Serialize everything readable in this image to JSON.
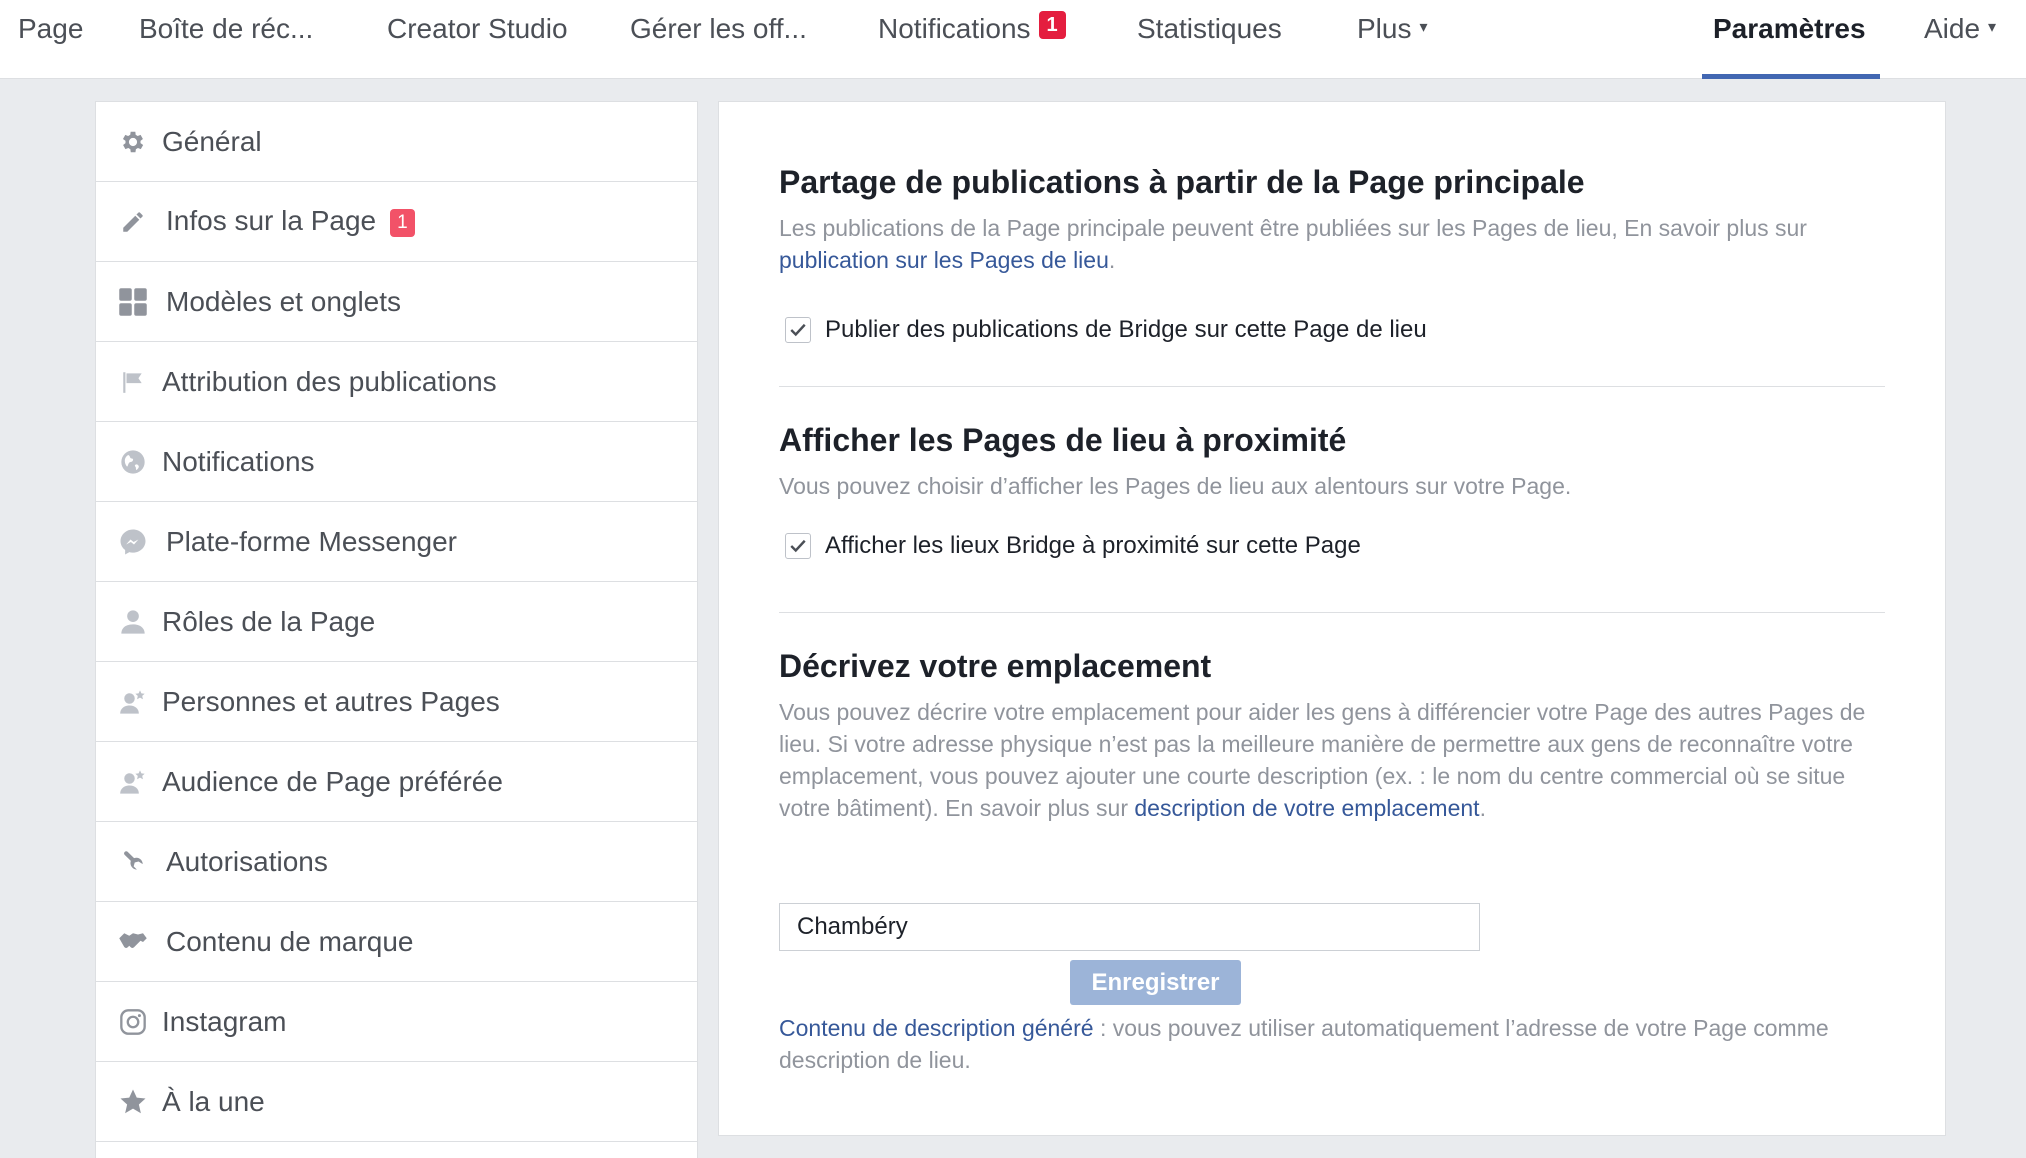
{
  "topnav": {
    "items": [
      {
        "label": "Page"
      },
      {
        "label": "Boîte de réc..."
      },
      {
        "label": "Creator Studio"
      },
      {
        "label": "Gérer les off..."
      },
      {
        "label": "Notifications",
        "badge": "1"
      },
      {
        "label": "Statistiques"
      },
      {
        "label": "Plus"
      },
      {
        "label": "Paramètres"
      },
      {
        "label": "Aide"
      }
    ],
    "caret": "▾",
    "accent_color": "#4267b2"
  },
  "sidebar": {
    "items": [
      {
        "label": "Général",
        "icon": "gear-icon"
      },
      {
        "label": "Infos sur la Page",
        "icon": "pencil-icon",
        "badge": "1"
      },
      {
        "label": "Modèles et onglets",
        "icon": "grid-icon"
      },
      {
        "label": "Attribution des publications",
        "icon": "flag-icon"
      },
      {
        "label": "Notifications",
        "icon": "globe-icon"
      },
      {
        "label": "Plate-forme Messenger",
        "icon": "messenger-icon"
      },
      {
        "label": "Rôles de la Page",
        "icon": "person-icon"
      },
      {
        "label": "Personnes et autres Pages",
        "icon": "person-star-icon"
      },
      {
        "label": "Audience de Page préférée",
        "icon": "person-star-icon"
      },
      {
        "label": "Autorisations",
        "icon": "wrench-icon"
      },
      {
        "label": "Contenu de marque",
        "icon": "handshake-icon"
      },
      {
        "label": "Instagram",
        "icon": "instagram-icon"
      },
      {
        "label": "À la une",
        "icon": "star-icon"
      }
    ]
  },
  "main": {
    "section1": {
      "title": "Partage de publications à partir de la Page principale",
      "desc": "Les publications de la Page principale peuvent être publiées sur les Pages de lieu, En savoir plus sur ",
      "link": "publication sur les Pages de lieu",
      "desc_end": ".",
      "checkbox_label": "Publier des publications de Bridge sur cette Page de lieu",
      "checked": true
    },
    "section2": {
      "title": "Afficher les Pages de lieu à proximité",
      "desc": "Vous pouvez choisir d’afficher les Pages de lieu aux alentours sur votre Page.",
      "checkbox_label": "Afficher les lieux Bridge à proximité sur cette Page",
      "checked": true
    },
    "section3": {
      "title": "Décrivez votre emplacement",
      "desc": "Vous pouvez décrire votre emplacement pour aider les gens à différencier votre Page des autres Pages de lieu. Si votre adresse physique n’est pas la meilleure manière de permettre aux gens de reconnaître votre emplacement, vous pouvez ajouter une courte description (ex. : le nom du centre commercial où se situe votre bâtiment). En savoir plus sur ",
      "link": "description de votre emplacement",
      "desc_end": ".",
      "input_value": "Chambéry",
      "save_label": "Enregistrer",
      "footnote_link": "Contenu de description généré",
      "footnote_text": " : vous pouvez utiliser automatiquement l’adresse de votre Page comme description de lieu."
    }
  }
}
